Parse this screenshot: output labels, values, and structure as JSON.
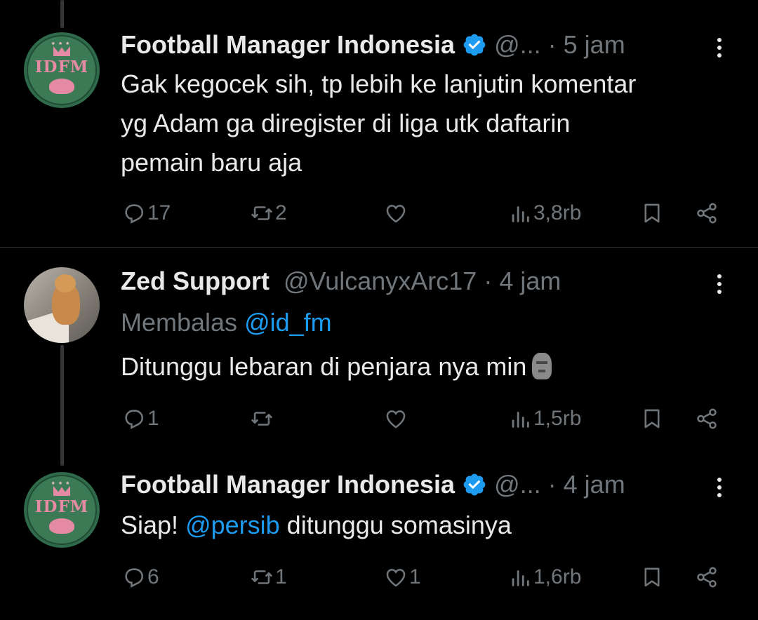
{
  "tweets": [
    {
      "author_name": "Football Manager Indonesia",
      "verified": true,
      "handle": "@...",
      "dot": "·",
      "time": "5 jam",
      "avatar_text": "IDFM",
      "body_lines": [
        "Gak kegocek sih, tp lebih ke lanjutin komentar",
        "yg Adam ga diregister di liga utk daftarin",
        "pemain baru aja"
      ],
      "replies": "17",
      "retweets": "2",
      "likes": "",
      "views": "3,8rb"
    },
    {
      "author_name": "Zed Support",
      "verified": false,
      "handle": "@VulcanyxArc17",
      "dot": "·",
      "time": "4 jam",
      "replying_label": "Membalas",
      "replying_to": "@id_fm",
      "body_text": "Ditunggu lebaran di penjara nya min",
      "emoji": "moai",
      "replies": "1",
      "retweets": "",
      "likes": "",
      "views": "1,5rb"
    },
    {
      "author_name": "Football Manager Indonesia",
      "verified": true,
      "handle": "@...",
      "dot": "·",
      "time": "4 jam",
      "avatar_text": "IDFM",
      "body_prefix": "Siap! ",
      "body_mention": "@persib",
      "body_suffix": " ditunggu somasinya",
      "replies": "6",
      "retweets": "1",
      "likes": "1",
      "views": "1,6rb"
    }
  ],
  "colors": {
    "background": "#000000",
    "text": "#e7e9ea",
    "muted": "#71767b",
    "accent": "#1d9bf0"
  },
  "icons": [
    "reply-icon",
    "retweet-icon",
    "like-icon",
    "views-icon",
    "bookmark-icon",
    "share-icon",
    "verified-badge-icon",
    "more-icon"
  ]
}
